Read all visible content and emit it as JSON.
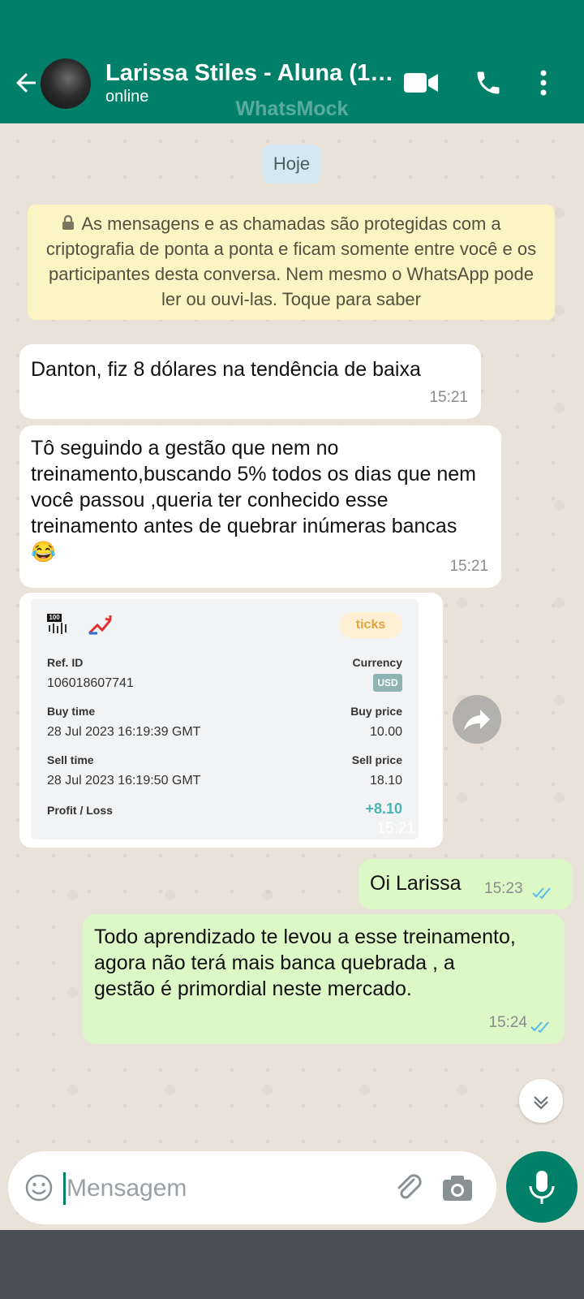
{
  "header": {
    "title": "Larissa Stiles - Aluna (1…",
    "status": "online",
    "watermark": "WhatsMock"
  },
  "chat": {
    "date_label": "Hoje",
    "encryption_notice": "As mensagens e as chamadas são protegidas com a criptografia de ponta a ponta e ficam somente entre você e os participantes desta conversa. Nem mesmo o WhatsApp pode ler ou ouvi-las. Toque para saber",
    "messages": [
      {
        "direction": "incoming",
        "text": "Danton, fiz 8 dólares na tendência de baixa",
        "time": "15:21"
      },
      {
        "direction": "incoming",
        "text": "Tô seguindo a gestão que nem no treinamento,buscando 5% todos os dias que nem você passou ,queria ter conhecido esse treinamento antes de quebrar inúmeras bancas",
        "emoji": "😂",
        "time": "15:21"
      },
      {
        "direction": "incoming",
        "type": "image",
        "time": "15:21"
      },
      {
        "direction": "outgoing",
        "text": "Oi Larissa",
        "time": "15:23",
        "read": true
      },
      {
        "direction": "outgoing",
        "text": "Todo aprendizado te levou a esse treinamento, agora não terá mais banca quebrada , a gestão é primordial neste mercado.",
        "time": "15:24",
        "read": true
      }
    ],
    "trade_card": {
      "badge_100": "100",
      "brand_tag": "ticks",
      "ref_id_label": "Ref. ID",
      "ref_id": "106018607741",
      "currency_label": "Currency",
      "currency": "USD",
      "buy_time_label": "Buy time",
      "buy_time": "28 Jul 2023 16:19:39 GMT",
      "buy_price_label": "Buy price",
      "buy_price": "10.00",
      "sell_time_label": "Sell time",
      "sell_time": "28 Jul 2023 16:19:50 GMT",
      "sell_price_label": "Sell price",
      "sell_price": "18.10",
      "profit_label": "Profit / Loss",
      "profit": "+8.10"
    }
  },
  "composer": {
    "placeholder": "Mensagem"
  },
  "colors": {
    "header": "#008069",
    "incoming_bubble": "#ffffff",
    "outgoing_bubble": "#dcf8c6",
    "read_ticks": "#53bdeb",
    "profit": "#4bb4b3",
    "ticks_tag_bg": "#fdf0d5",
    "ticks_tag_text": "#e3a33d"
  },
  "icons": [
    "back-arrow-icon",
    "video-call-icon",
    "phone-icon",
    "more-vert-icon",
    "lock-icon",
    "forward-icon",
    "scroll-down-icon",
    "emoji-icon",
    "attach-icon",
    "camera-icon",
    "mic-icon",
    "double-check-icon"
  ]
}
